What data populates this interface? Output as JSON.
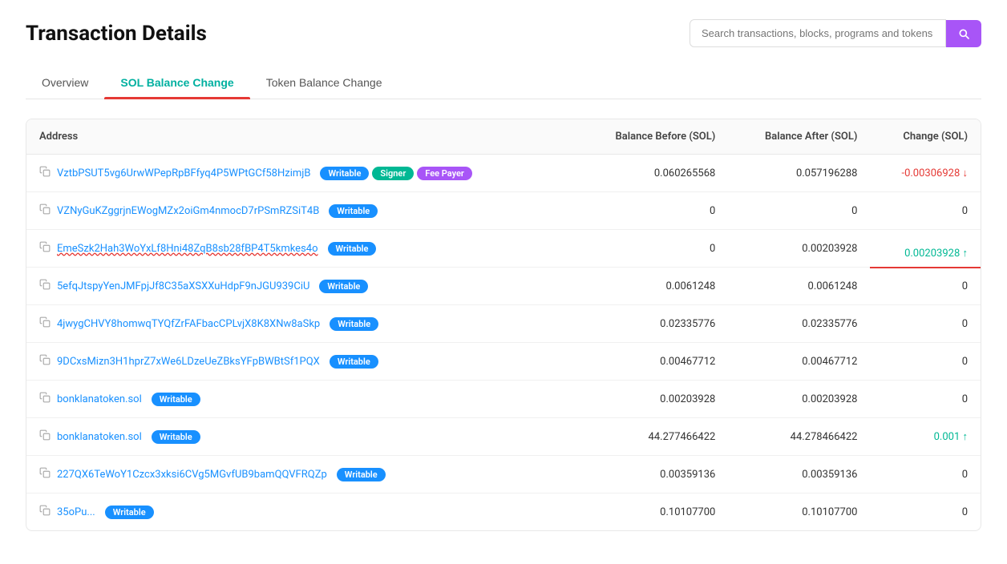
{
  "page": {
    "title": "Transaction Details",
    "search_placeholder": "Search transactions, blocks, programs and tokens"
  },
  "tabs": [
    {
      "id": "overview",
      "label": "Overview",
      "active": false
    },
    {
      "id": "sol-balance",
      "label": "SOL Balance Change",
      "active": true
    },
    {
      "id": "token-balance",
      "label": "Token Balance Change",
      "active": false
    }
  ],
  "table": {
    "columns": [
      "Address",
      "Balance Before (SOL)",
      "Balance After (SOL)",
      "Change (SOL)"
    ],
    "rows": [
      {
        "address": "VztbPSUT5vg6UrwWPepRpBFfyq4P5WPtGCf58HzimjB",
        "badges": [
          "Writable",
          "Signer",
          "Fee Payer"
        ],
        "balance_before": "0.060265568",
        "balance_after": "0.057196288",
        "change": "-0.00306928",
        "change_type": "negative",
        "underline": false
      },
      {
        "address": "VZNyGuKZggrjnEWogMZx2oiGm4nmocD7rPSmRZSiT4B",
        "badges": [
          "Writable"
        ],
        "balance_before": "0",
        "balance_after": "0",
        "change": "0",
        "change_type": "zero",
        "underline": false
      },
      {
        "address": "EmeSzk2Hah3WoYxLf8Hni48ZqB8sb28fBP4T5kmkes4o",
        "badges": [
          "Writable"
        ],
        "balance_before": "0",
        "balance_after": "0.00203928",
        "change": "0.00203928",
        "change_type": "positive",
        "underline": true
      },
      {
        "address": "5efqJtspyYenJMFpjJf8C35aXSXXuHdpF9nJGU939CiU",
        "badges": [
          "Writable"
        ],
        "balance_before": "0.0061248",
        "balance_after": "0.0061248",
        "change": "0",
        "change_type": "zero",
        "underline": false
      },
      {
        "address": "4jwygCHVY8homwqTYQfZrFAFbacCPLvjX8K8XNw8aSkp",
        "badges": [
          "Writable"
        ],
        "balance_before": "0.02335776",
        "balance_after": "0.02335776",
        "change": "0",
        "change_type": "zero",
        "underline": false
      },
      {
        "address": "9DCxsMizn3H1hprZ7xWe6LDzeUeZBksYFpBWBtSf1PQX",
        "badges": [
          "Writable"
        ],
        "balance_before": "0.00467712",
        "balance_after": "0.00467712",
        "change": "0",
        "change_type": "zero",
        "underline": false
      },
      {
        "address": "bonklanatoken.sol",
        "badges": [
          "Writable"
        ],
        "balance_before": "0.00203928",
        "balance_after": "0.00203928",
        "change": "0",
        "change_type": "zero",
        "underline": false
      },
      {
        "address": "bonklanatoken.sol",
        "badges": [
          "Writable"
        ],
        "balance_before": "44.277466422",
        "balance_after": "44.278466422",
        "change": "0.001",
        "change_type": "positive",
        "underline": false
      },
      {
        "address": "227QX6TeWoY1Czcx3xksi6CVg5MGvfUB9bamQQVFRQZp",
        "badges": [
          "Writable"
        ],
        "balance_before": "0.00359136",
        "balance_after": "0.00359136",
        "change": "0",
        "change_type": "zero",
        "underline": false
      },
      {
        "address": "35oPu...",
        "badges": [
          "Writable"
        ],
        "balance_before": "0.10107700",
        "balance_after": "0.10107700",
        "change": "0",
        "change_type": "zero",
        "underline": false
      }
    ]
  }
}
